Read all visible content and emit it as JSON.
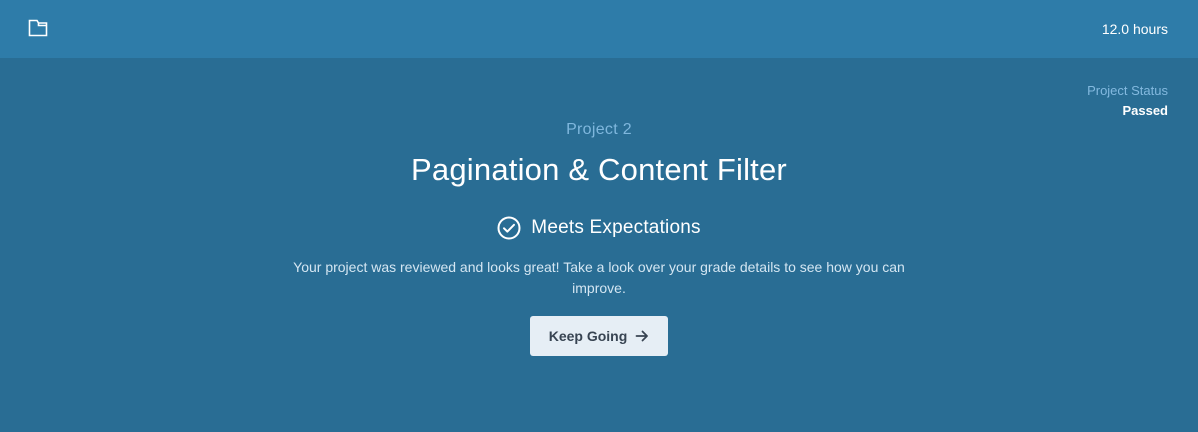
{
  "header": {
    "icon": "folder-icon",
    "hours": "12.0 hours"
  },
  "status": {
    "label": "Project Status",
    "value": "Passed"
  },
  "project": {
    "number": "Project 2",
    "title": "Pagination & Content Filter"
  },
  "result": {
    "icon": "check-circle-icon",
    "label": "Meets Expectations",
    "message": "Your project was reviewed and looks great! Take a look over your grade details to see how you can improve."
  },
  "action": {
    "label": "Keep Going",
    "icon": "arrow-right-icon"
  },
  "colors": {
    "topbar": "#2e7ca9",
    "background": "#296d94",
    "accent_text": "#7fb7dd",
    "button_bg": "#e6eef5"
  }
}
